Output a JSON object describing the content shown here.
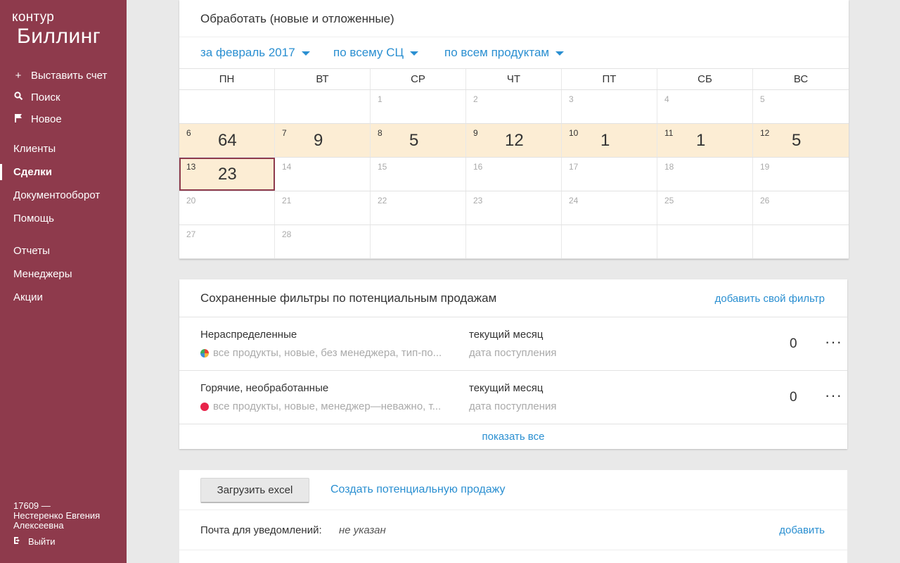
{
  "sidebar": {
    "logo_top": "контур",
    "logo_bottom": "Биллинг",
    "actions": [
      {
        "icon": "plus-icon",
        "label": "Выставить счет"
      },
      {
        "icon": "search-icon",
        "label": "Поиск"
      },
      {
        "icon": "flag-icon",
        "label": "Новое"
      }
    ],
    "nav_group1": [
      "Клиенты",
      "Сделки",
      "Документооборот",
      "Помощь"
    ],
    "nav_group2": [
      "Отчеты",
      "Менеджеры",
      "Акции"
    ],
    "active_item": "Сделки",
    "user_id": "17609 —",
    "user_name": "Нестеренко Евгения Алексеевна",
    "logout": "Выйти"
  },
  "calendar_panel": {
    "title": "Обработать (новые и отложенные)",
    "filters": [
      "за февраль 2017",
      "по всему СЦ",
      "по всем продуктам"
    ],
    "weekdays": [
      "ПН",
      "ВТ",
      "СР",
      "ЧТ",
      "ПТ",
      "СБ",
      "ВС"
    ],
    "weeks": [
      [
        {
          "d": ""
        },
        {
          "d": ""
        },
        {
          "d": "1"
        },
        {
          "d": "2"
        },
        {
          "d": "3"
        },
        {
          "d": "4"
        },
        {
          "d": "5"
        }
      ],
      [
        {
          "d": "6",
          "n": "64"
        },
        {
          "d": "7",
          "n": "9"
        },
        {
          "d": "8",
          "n": "5"
        },
        {
          "d": "9",
          "n": "12"
        },
        {
          "d": "10",
          "n": "1"
        },
        {
          "d": "11",
          "n": "1"
        },
        {
          "d": "12",
          "n": "5"
        }
      ],
      [
        {
          "d": "13",
          "n": "23",
          "selected": true
        },
        {
          "d": "14"
        },
        {
          "d": "15"
        },
        {
          "d": "16"
        },
        {
          "d": "17"
        },
        {
          "d": "18"
        },
        {
          "d": "19"
        }
      ],
      [
        {
          "d": "20"
        },
        {
          "d": "21"
        },
        {
          "d": "22"
        },
        {
          "d": "23"
        },
        {
          "d": "24"
        },
        {
          "d": "25"
        },
        {
          "d": "26"
        }
      ],
      [
        {
          "d": "27"
        },
        {
          "d": "28"
        },
        {
          "d": ""
        },
        {
          "d": ""
        },
        {
          "d": ""
        },
        {
          "d": ""
        },
        {
          "d": ""
        }
      ]
    ]
  },
  "saved_filters": {
    "title": "Сохраненные фильтры по потенциальным продажам",
    "add_link": "добавить свой фильтр",
    "rows": [
      {
        "name": "Нераспределенные",
        "desc": "все продукты, новые, без менеджера, тип-по...",
        "dot": "multi",
        "period": "текущий месяц",
        "date_label": "дата поступления",
        "count": "0",
        "more": "···"
      },
      {
        "name": "Горячие, необработанные",
        "desc": "все продукты, новые, менеджер—неважно, т...",
        "dot": "red",
        "period": "текущий месяц",
        "date_label": "дата поступления",
        "count": "0",
        "more": "···"
      }
    ],
    "show_all": "показать все"
  },
  "bottom_panel": {
    "excel_button": "Загрузить excel",
    "create_link": "Создать потенциальную продажу",
    "mail_label": "Почта для уведомлений:",
    "mail_value": "не указан",
    "mail_add": "добавить"
  }
}
